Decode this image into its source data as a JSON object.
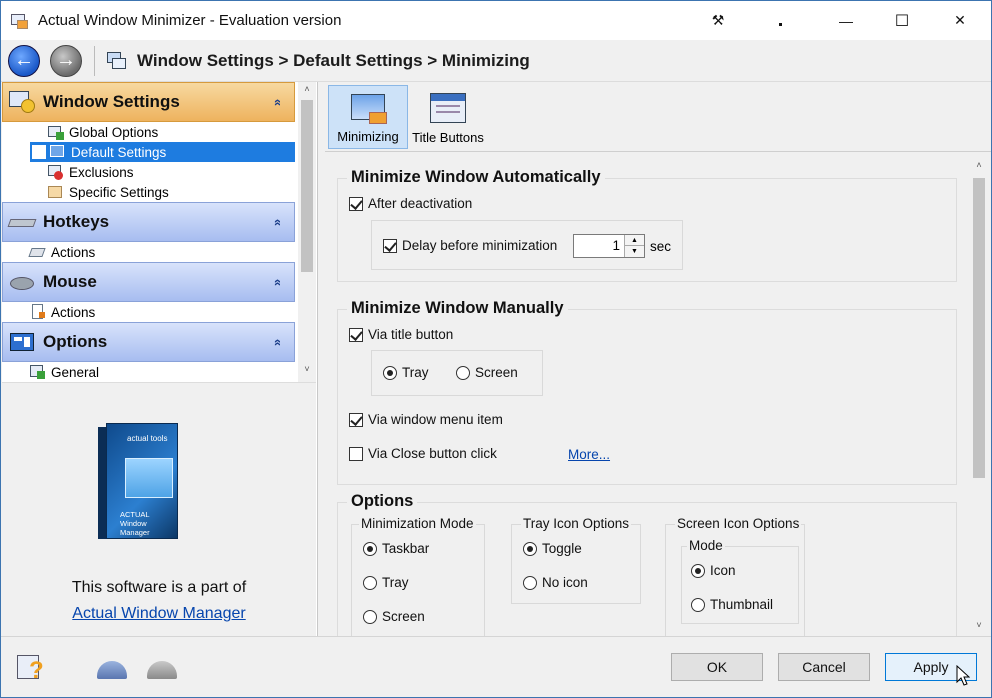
{
  "window": {
    "title": "Actual Window Minimizer - Evaluation version",
    "tool_icon": "⚒",
    "minimize_glyph": "—",
    "maximize_glyph": "☐",
    "close_glyph": "✕"
  },
  "nav": {
    "back_glyph": "←",
    "forward_glyph": "→",
    "breadcrumb": "Window Settings > Default Settings > Minimizing"
  },
  "sidebar": {
    "chevron": "»",
    "categories": [
      {
        "label": "Window Settings",
        "items": [
          "Global Options",
          "Default Settings",
          "Exclusions",
          "Specific Settings"
        ]
      },
      {
        "label": "Hotkeys",
        "items": [
          "Actions"
        ]
      },
      {
        "label": "Mouse",
        "items": [
          "Actions"
        ]
      },
      {
        "label": "Options",
        "items": [
          "General"
        ]
      }
    ],
    "scroll_up": "˄",
    "scroll_down": "˅"
  },
  "promo": {
    "brand": "actual tools",
    "product_line1": "ACTUAL",
    "product_line2": "Window Manager",
    "text": "This software is a part of",
    "link": "Actual Window Manager"
  },
  "tabs": [
    {
      "label": "Minimizing",
      "active": true
    },
    {
      "label": "Title Buttons",
      "active": false
    }
  ],
  "sections": {
    "auto": {
      "title": "Minimize Window Automatically",
      "after_deactivation": {
        "label": "After deactivation",
        "checked": true
      },
      "delay": {
        "label": "Delay before minimization",
        "checked": true,
        "value": "1",
        "unit": "sec"
      }
    },
    "manual": {
      "title": "Minimize Window Manually",
      "via_title_button": {
        "label": "Via title button",
        "checked": true
      },
      "target_options": [
        "Tray",
        "Screen"
      ],
      "target_selected": "Tray",
      "via_window_menu": {
        "label": "Via window menu item",
        "checked": true
      },
      "via_close": {
        "label": "Via Close button click",
        "checked": false
      },
      "more_link": "More..."
    },
    "options": {
      "title": "Options",
      "minimization_mode": {
        "title": "Minimization Mode",
        "choices": [
          "Taskbar",
          "Tray",
          "Screen"
        ],
        "selected": "Taskbar"
      },
      "tray_icon": {
        "title": "Tray Icon Options",
        "choices": [
          "Toggle",
          "No icon"
        ],
        "selected": "Toggle"
      },
      "screen_icon": {
        "title": "Screen Icon Options",
        "mode_title": "Mode",
        "choices": [
          "Icon",
          "Thumbnail"
        ],
        "selected": "Icon"
      }
    }
  },
  "buttons": {
    "ok": "OK",
    "cancel": "Cancel",
    "apply": "Apply"
  }
}
